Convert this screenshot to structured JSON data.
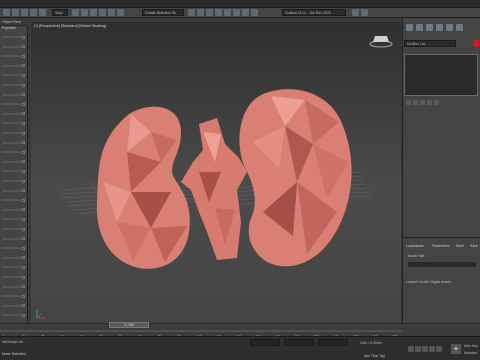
{
  "toolbar": {
    "filter_value": "Vispl",
    "selection_set_value": "Create Selection Se",
    "workspace_label": "Custom UI Cl... Sin Rev 2025"
  },
  "left_panel": {
    "tab_label": "Object Paint",
    "scene_label": "Populate"
  },
  "viewport": {
    "label": "[+] [Perspective] [Standard] [Default Shading]"
  },
  "right_panel": {
    "object_name": "Modifier List",
    "object_color": "#c0202a",
    "tabs": [
      "LoadAssets",
      "Parameters",
      "Shell",
      "Save"
    ],
    "asset_path_label": "Asset Path",
    "loaded_label": "Loaded Houdini Digital Assets"
  },
  "timeline": {
    "slider_label": "0 / 200",
    "ticks": [
      "0",
      "10",
      "20",
      "30",
      "40",
      "50",
      "60",
      "70",
      "80",
      "90",
      "100",
      "110",
      "120",
      "130",
      "140",
      "150",
      "160",
      "170",
      "180",
      "190",
      "200"
    ]
  },
  "status": {
    "message": "None Selected",
    "prompt": "Click or click-and-drag to select objects",
    "grid_label": "Grid = 0.254m",
    "add_time_tag": "Add Time Tag",
    "auto_key": "Auto Key",
    "selected": "Selected",
    "set_key": "Set Key",
    "key_filters": "Key Filters..."
  },
  "colors": {
    "accent": "#5aa0d6",
    "kidney": "#d97f74"
  }
}
